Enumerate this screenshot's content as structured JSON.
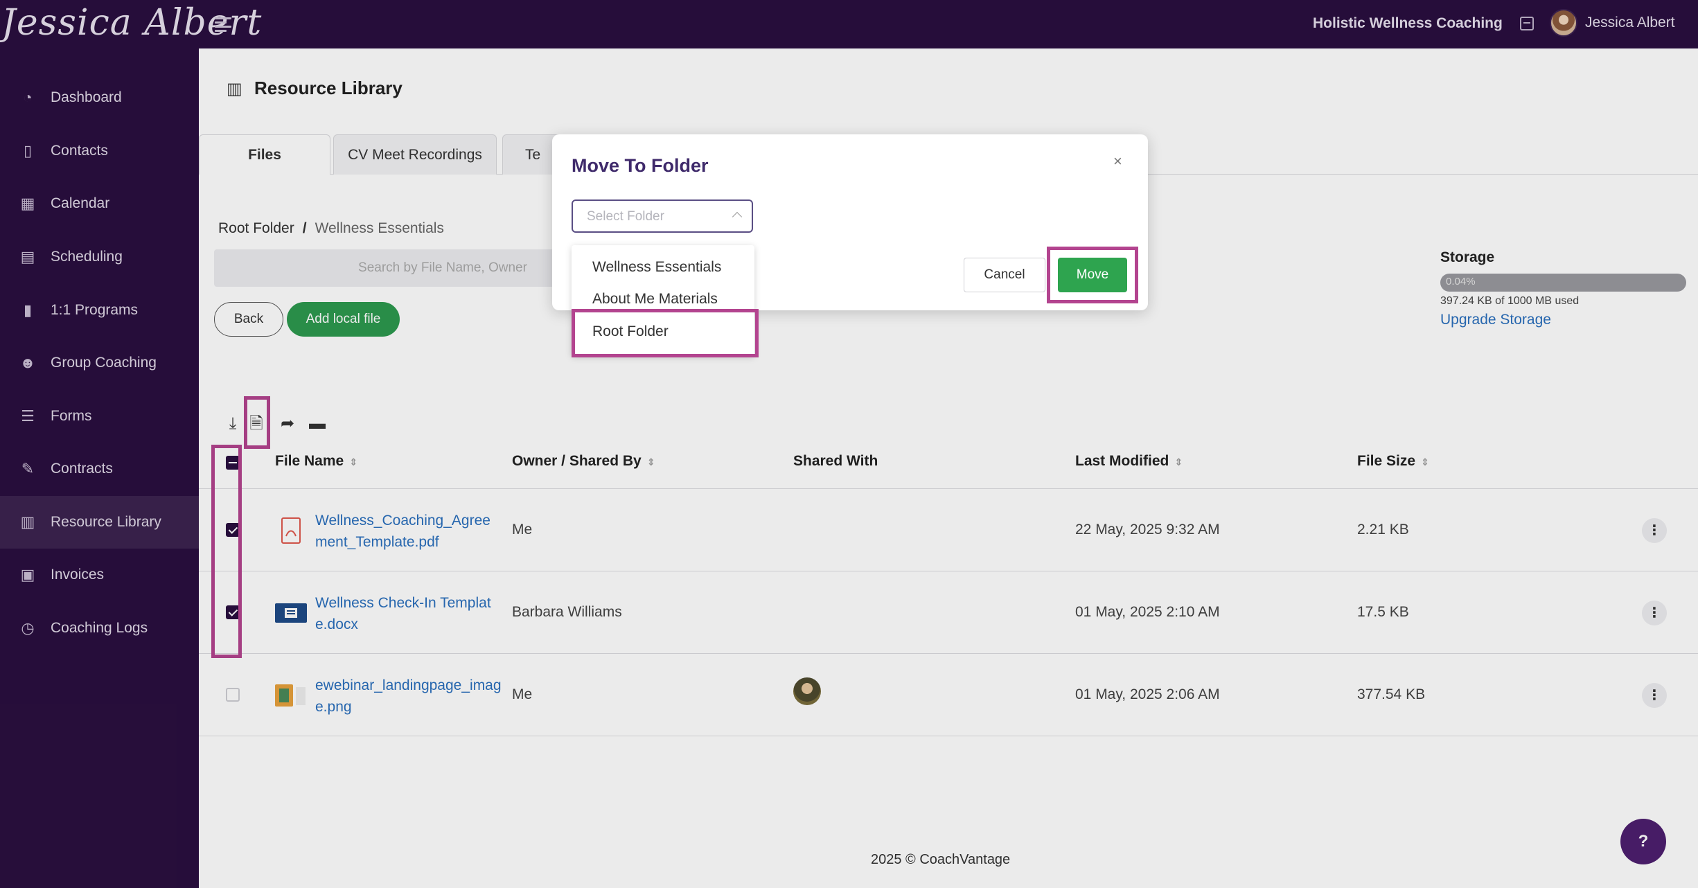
{
  "header": {
    "logo_text": "Jessica Albert",
    "org_name": "Holistic Wellness Coaching",
    "user_name": "Jessica Albert"
  },
  "sidebar": {
    "items": [
      {
        "label": "Dashboard",
        "icon": "dashboard-icon"
      },
      {
        "label": "Contacts",
        "icon": "contacts-icon"
      },
      {
        "label": "Calendar",
        "icon": "calendar-icon"
      },
      {
        "label": "Scheduling",
        "icon": "scheduling-icon"
      },
      {
        "label": "1:1 Programs",
        "icon": "book-icon"
      },
      {
        "label": "Group Coaching",
        "icon": "group-icon"
      },
      {
        "label": "Forms",
        "icon": "forms-icon"
      },
      {
        "label": "Contracts",
        "icon": "contract-icon"
      },
      {
        "label": "Resource Library",
        "icon": "library-icon",
        "active": true
      },
      {
        "label": "Invoices",
        "icon": "invoice-icon"
      },
      {
        "label": "Coaching Logs",
        "icon": "clock-icon"
      }
    ]
  },
  "main": {
    "title": "Resource Library",
    "tabs": [
      {
        "label": "Files",
        "active": true
      },
      {
        "label": "CV Meet Recordings"
      },
      {
        "label": "Te"
      }
    ],
    "breadcrumb": {
      "root": "Root Folder",
      "separator": "/",
      "current": "Wellness Essentials"
    },
    "search_placeholder": "Search by File Name, Owner",
    "back_label": "Back",
    "add_label": "Add local file",
    "storage": {
      "title": "Storage",
      "percent_text": "0.04%",
      "used_fraction": 0.0004,
      "used_text": "397.24 KB of 1000 MB used",
      "upgrade_label": "Upgrade Storage"
    },
    "table": {
      "columns": [
        "File Name",
        "Owner / Shared By",
        "Shared With",
        "Last Modified",
        "File Size"
      ],
      "rows": [
        {
          "name": "Wellness_Coaching_Agreement_Template.pdf",
          "owner": "Me",
          "shared_with": "",
          "modified": "22 May, 2025 9:32 AM",
          "size": "2.21 KB",
          "checked": true,
          "type": "pdf-icon"
        },
        {
          "name": "Wellness Check-In Template.docx",
          "owner": "Barbara Williams",
          "shared_with": "",
          "modified": "01 May, 2025 2:10 AM",
          "size": "17.5 KB",
          "checked": true,
          "type": "word-icon"
        },
        {
          "name": "ewebinar_landingpage_image.png",
          "owner": "Me",
          "shared_with": "avatar",
          "modified": "01 May, 2025 2:06 AM",
          "size": "377.54 KB",
          "checked": false,
          "type": "image-icon"
        }
      ]
    },
    "footer": "2025 © CoachVantage",
    "help_label": "?"
  },
  "modal": {
    "title": "Move To Folder",
    "close_label": "×",
    "select_placeholder": "Select Folder",
    "options": [
      "Wellness Essentials",
      "About Me Materials",
      "Root Folder"
    ],
    "cancel_label": "Cancel",
    "move_label": "Move"
  },
  "colors": {
    "sidebar_bg": "#2a0f3f",
    "accent_green": "#2ea44f",
    "highlight": "#b3448f",
    "link_blue": "#2a6fbd"
  }
}
